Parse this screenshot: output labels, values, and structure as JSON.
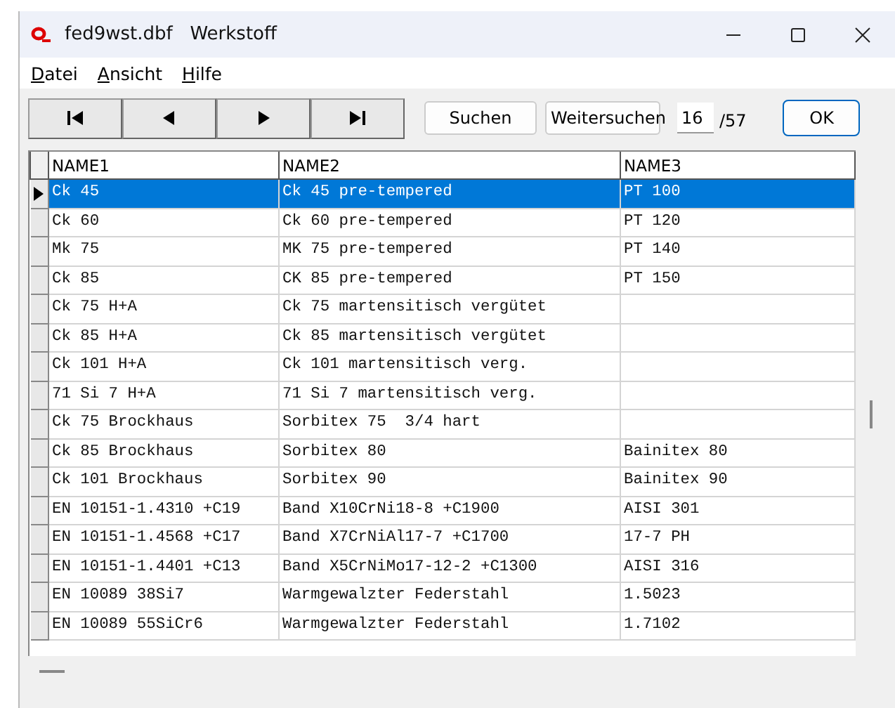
{
  "window": {
    "title": "fed9wst.dbf   Werkstoff"
  },
  "menu": [
    "Datei",
    "Ansicht",
    "Hilfe"
  ],
  "toolbar": {
    "nav_buttons": [
      {
        "kind": "first"
      },
      {
        "kind": "prev"
      },
      {
        "kind": "next"
      },
      {
        "kind": "last"
      }
    ],
    "search_button": "Suchen",
    "next_search_button": "Weitersuchen",
    "record": "16",
    "total": "/57",
    "ok_button": "OK"
  },
  "table": {
    "columns": [
      "NAME1",
      "NAME2",
      "NAME3"
    ],
    "rows": [
      {
        "selected": true,
        "cells": [
          "Ck 45",
          "Ck 45 pre-tempered",
          "PT 100"
        ]
      },
      {
        "selected": false,
        "cells": [
          "Ck 60",
          "Ck 60 pre-tempered",
          "PT 120"
        ]
      },
      {
        "selected": false,
        "cells": [
          "Mk 75",
          "MK 75 pre-tempered",
          "PT 140"
        ]
      },
      {
        "selected": false,
        "cells": [
          "Ck 85",
          "CK 85 pre-tempered",
          "PT 150"
        ]
      },
      {
        "selected": false,
        "cells": [
          "Ck 75 H+A",
          "Ck 75 martensitisch vergütet",
          ""
        ]
      },
      {
        "selected": false,
        "cells": [
          "Ck 85 H+A",
          "Ck 85 martensitisch vergütet",
          ""
        ]
      },
      {
        "selected": false,
        "cells": [
          "Ck 101 H+A",
          "Ck 101 martensitisch verg.",
          ""
        ]
      },
      {
        "selected": false,
        "cells": [
          "71 Si 7 H+A",
          "71 Si 7 martensitisch verg.",
          ""
        ]
      },
      {
        "selected": false,
        "cells": [
          "Ck 75 Brockhaus",
          "Sorbitex 75  3/4 hart",
          ""
        ]
      },
      {
        "selected": false,
        "cells": [
          "Ck 85 Brockhaus",
          "Sorbitex 80",
          "Bainitex 80"
        ]
      },
      {
        "selected": false,
        "cells": [
          "Ck 101 Brockhaus",
          "Sorbitex 90",
          "Bainitex 90"
        ]
      },
      {
        "selected": false,
        "cells": [
          "EN 10151-1.4310 +C19",
          "Band X10CrNi18-8 +C1900",
          "AISI 301"
        ]
      },
      {
        "selected": false,
        "cells": [
          "EN 10151-1.4568 +C17",
          "Band X7CrNiAl17-7 +C1700",
          "17-7 PH"
        ]
      },
      {
        "selected": false,
        "cells": [
          "EN 10151-1.4401 +C13",
          "Band X5CrNiMo17-12-2 +C1300",
          "AISI 316"
        ]
      },
      {
        "selected": false,
        "cells": [
          "EN 10089 38Si7",
          "Warmgewalzter Federstahl",
          "1.5023"
        ]
      },
      {
        "selected": false,
        "cells": [
          "EN 10089 55SiCr6",
          "Warmgewalzter Federstahl",
          "1.7102"
        ]
      }
    ]
  }
}
